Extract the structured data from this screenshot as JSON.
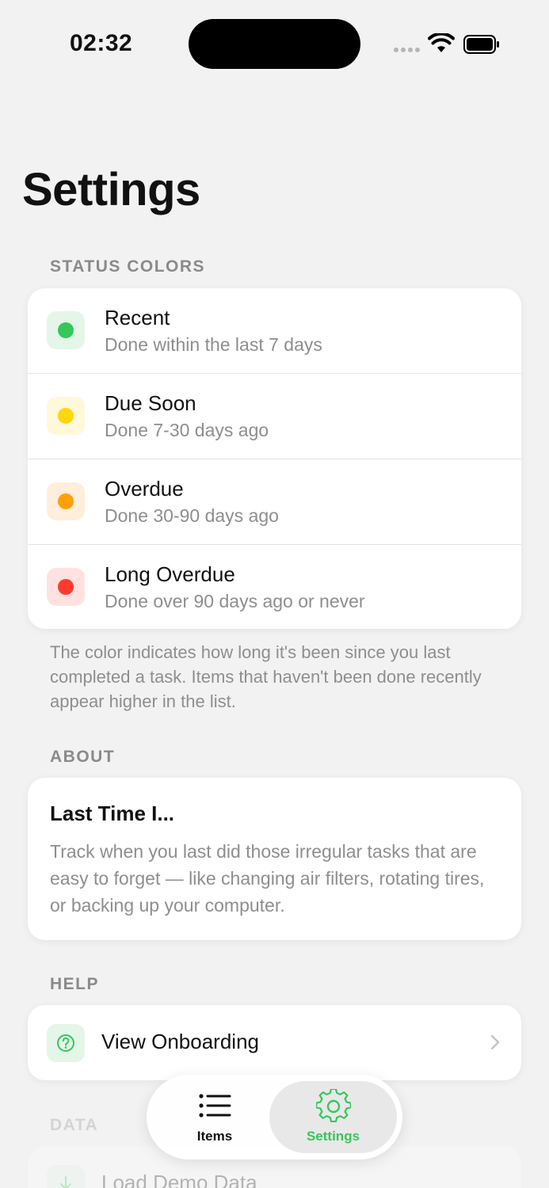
{
  "status_bar": {
    "time": "02:32"
  },
  "page": {
    "title": "Settings"
  },
  "status_colors": {
    "header": "STATUS COLORS",
    "items": [
      {
        "title": "Recent",
        "subtitle": "Done within the last 7 days",
        "color": "#34c759",
        "bg": "#e4f6e8"
      },
      {
        "title": "Due Soon",
        "subtitle": "Done 7-30 days ago",
        "color": "#ffd60a",
        "bg": "#fff8d9"
      },
      {
        "title": "Overdue",
        "subtitle": "Done 30-90 days ago",
        "color": "#ff9f0a",
        "bg": "#ffeedb"
      },
      {
        "title": "Long Overdue",
        "subtitle": "Done over 90 days ago or never",
        "color": "#ff3b30",
        "bg": "#ffe2e0"
      }
    ],
    "footnote": "The color indicates how long it's been since you last completed a task. Items that haven't been done recently appear higher in the list."
  },
  "about": {
    "header": "ABOUT",
    "title": "Last Time I...",
    "body": "Track when you last did those irregular tasks that are easy to forget — like changing air filters, rotating tires, or backing up your computer."
  },
  "help": {
    "header": "HELP",
    "view_onboarding": "View Onboarding",
    "icon": "question-circle-icon"
  },
  "data_section": {
    "header": "DATA",
    "load_demo": "Load Demo Data",
    "icon": "download-icon"
  },
  "tab_bar": {
    "items_label": "Items",
    "settings_label": "Settings",
    "accent": "#34c759"
  }
}
